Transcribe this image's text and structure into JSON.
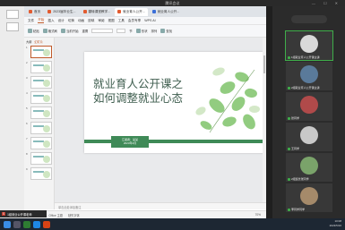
{
  "meeting": {
    "title": "腾讯会议",
    "presenter_badge": "S",
    "presenter_name": "1组就业公开课老师"
  },
  "tabs": [
    {
      "label": "首页",
      "color": "#e25b30"
    },
    {
      "label": "2023届毕业生...",
      "color": "#e25b30"
    },
    {
      "label": "翻转课堂教学...",
      "color": "#e25b30"
    },
    {
      "label": "就业育人公开...",
      "color": "#e25b30"
    },
    {
      "label": "就业育人公开...",
      "color": "#3b6fd8"
    }
  ],
  "menu": [
    "文件",
    "开始",
    "插入",
    "设计",
    "切换",
    "动画",
    "放映",
    "审阅",
    "视图",
    "工具",
    "会员专享",
    "WPS AI"
  ],
  "toolbar": {
    "paste": "粘贴",
    "new_slide": "当前开始",
    "format": "格式刷",
    "reset": "重置",
    "section": "节",
    "arrange": "排列",
    "shape": "形状",
    "find": "查找"
  },
  "thumbs": {
    "tab_outline": "大纲",
    "tab_slides": "幻灯片",
    "items": [
      "1",
      "2",
      "3",
      "4",
      "5",
      "6",
      "7",
      "8",
      "9"
    ]
  },
  "slide": {
    "title_line1": "就业育人公开课之",
    "title_line2": "如何调整就业心态",
    "box_line1": "汇报者：某某",
    "box_line2": "2023年4月"
  },
  "notes": "单击此处添加备注",
  "status": {
    "slide_num": "幻灯片 1 / 13",
    "theme": "Office 主题",
    "lang": "缺失字体",
    "zoom": "70%"
  },
  "participants": [
    {
      "name": "1组就业育人公开课主讲",
      "avatar_color": "#d9d9d9"
    },
    {
      "name": "2组就业育人公开课主讲",
      "avatar_color": "#5a7a9a"
    },
    {
      "name": "张同学",
      "avatar_color": "#b04a4a"
    },
    {
      "name": "王同学",
      "avatar_color": "#c8c8c8"
    },
    {
      "name": "2组班长张同学",
      "avatar_color": "#7aa36a"
    },
    {
      "name": "李同学同学",
      "avatar_color": "#a58a6a"
    },
    {
      "name": "张同",
      "avatar_color": "#dedede"
    },
    {
      "name": "赵同学",
      "avatar_color": "#6a8a6a"
    }
  ],
  "clock": {
    "time": "10:08",
    "date": "2023/5/16"
  }
}
